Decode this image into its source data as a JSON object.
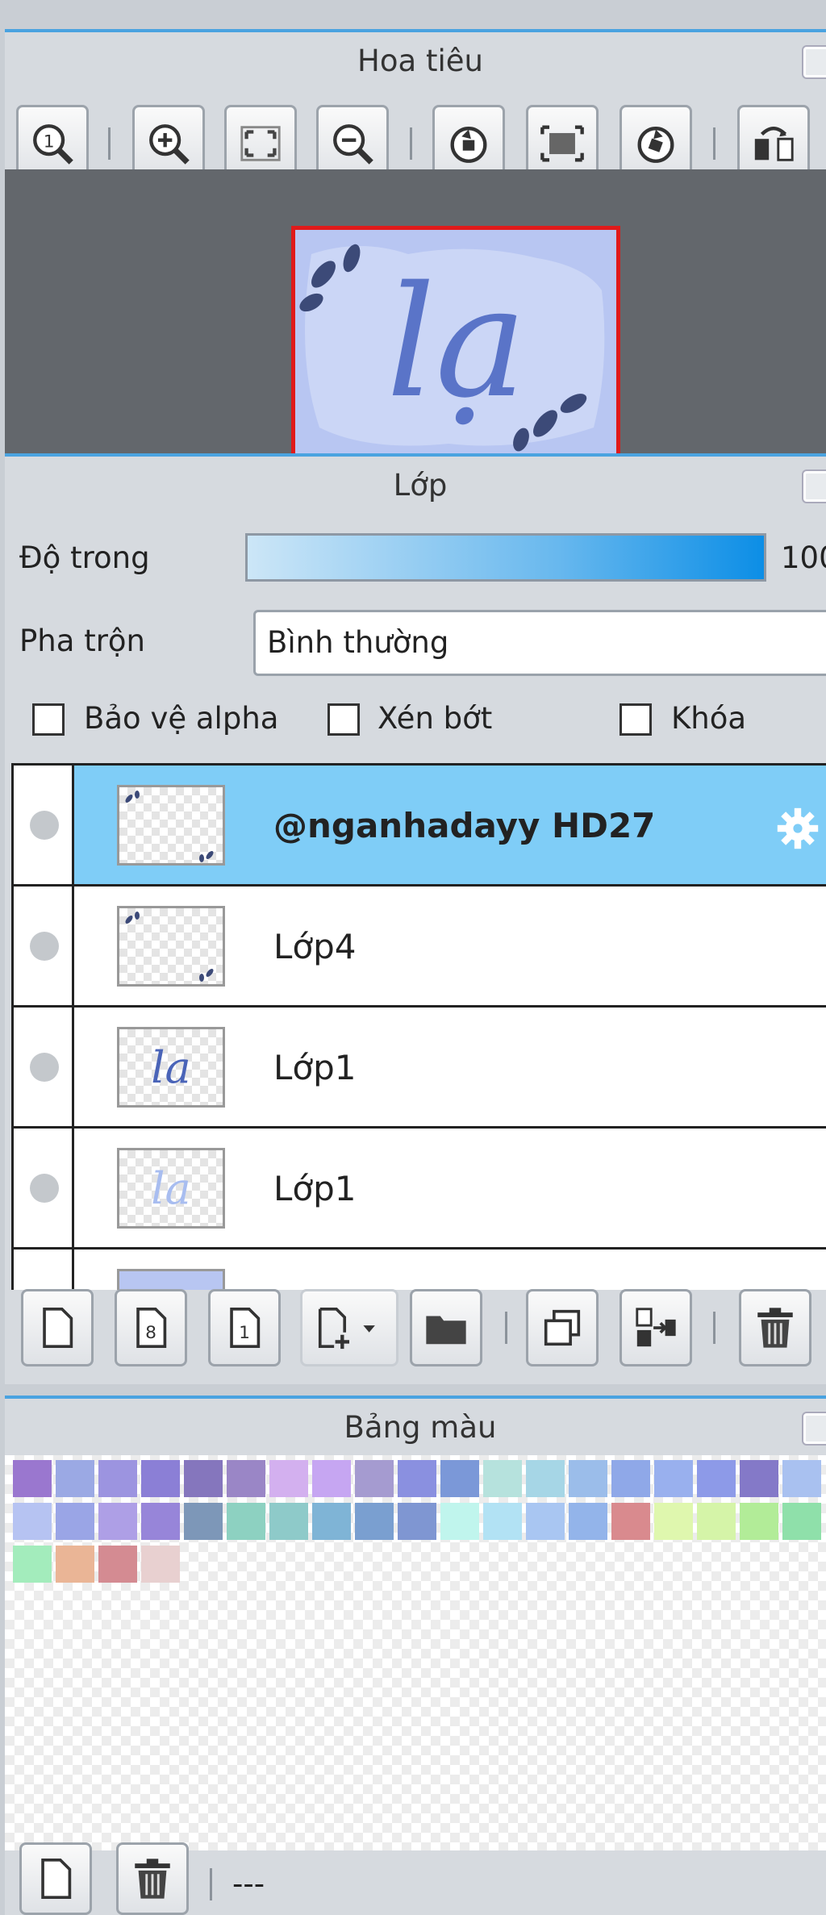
{
  "navigator": {
    "title": "Hoa tiêu",
    "toolbar": [
      {
        "name": "zoom-actual-icon"
      },
      {
        "name": "zoom-in-icon"
      },
      {
        "name": "fit-screen-icon"
      },
      {
        "name": "zoom-out-icon"
      },
      {
        "name": "rotate-left-icon"
      },
      {
        "name": "reset-view-icon"
      },
      {
        "name": "rotate-right-icon"
      },
      {
        "name": "flip-horizontal-icon"
      }
    ],
    "preview_text": "lạ"
  },
  "layers": {
    "title": "Lớp",
    "opacity_label": "Độ trong",
    "opacity_value": "100",
    "blend_label": "Pha trộn",
    "blend_value": "Bình thường",
    "protect_alpha_label": "Bảo vệ alpha",
    "clipping_label": "Xén bớt",
    "lock_label": "Khóa",
    "items": [
      {
        "name": "@nganhadayy HD27",
        "selected": true
      },
      {
        "name": "Lớp4",
        "selected": false
      },
      {
        "name": "Lớp1",
        "selected": false
      },
      {
        "name": "Lớp1",
        "selected": false
      }
    ],
    "toolbar": [
      {
        "name": "new-layer-icon"
      },
      {
        "name": "new-8bit-layer-icon",
        "text": "8"
      },
      {
        "name": "new-1bit-layer-icon",
        "text": "1"
      },
      {
        "name": "add-layer-dropdown-icon"
      },
      {
        "name": "new-folder-icon"
      },
      {
        "name": "duplicate-layer-icon"
      },
      {
        "name": "merge-layer-icon"
      },
      {
        "name": "delete-layer-icon"
      }
    ]
  },
  "palette": {
    "title": "Bảng màu",
    "colors": [
      "#9a77cf",
      "#9ba9e4",
      "#9c94e0",
      "#8b7fd6",
      "#8576bd",
      "#9a86c6",
      "#d3b0ef",
      "#c6a6f2",
      "#a59bd0",
      "#8a90e0",
      "#7b98d8",
      "#b6e2dd",
      "#a6d6e6",
      "#9bbdea",
      "#8fa8e8",
      "#99b0ee",
      "#8d9ae8",
      "#8479c8",
      "#a9c1f0",
      "#b6c3f2",
      "#9aa5e6",
      "#ae9fe6",
      "#9785d9",
      "#7d97b8",
      "#8dd1c1",
      "#8ecac9",
      "#7fb4d6",
      "#7a9fd0",
      "#7f96d2",
      "#c0f5ed",
      "#b2e2f4",
      "#a9c6f2",
      "#93b4ea",
      "#d98a8e",
      "#dff7ae",
      "#d5f4a8",
      "#b2ec98",
      "#8fe0aa",
      "#a3ecbc",
      "#eab596",
      "#d48b92",
      "#e8d0d0"
    ],
    "status_text": "---"
  }
}
